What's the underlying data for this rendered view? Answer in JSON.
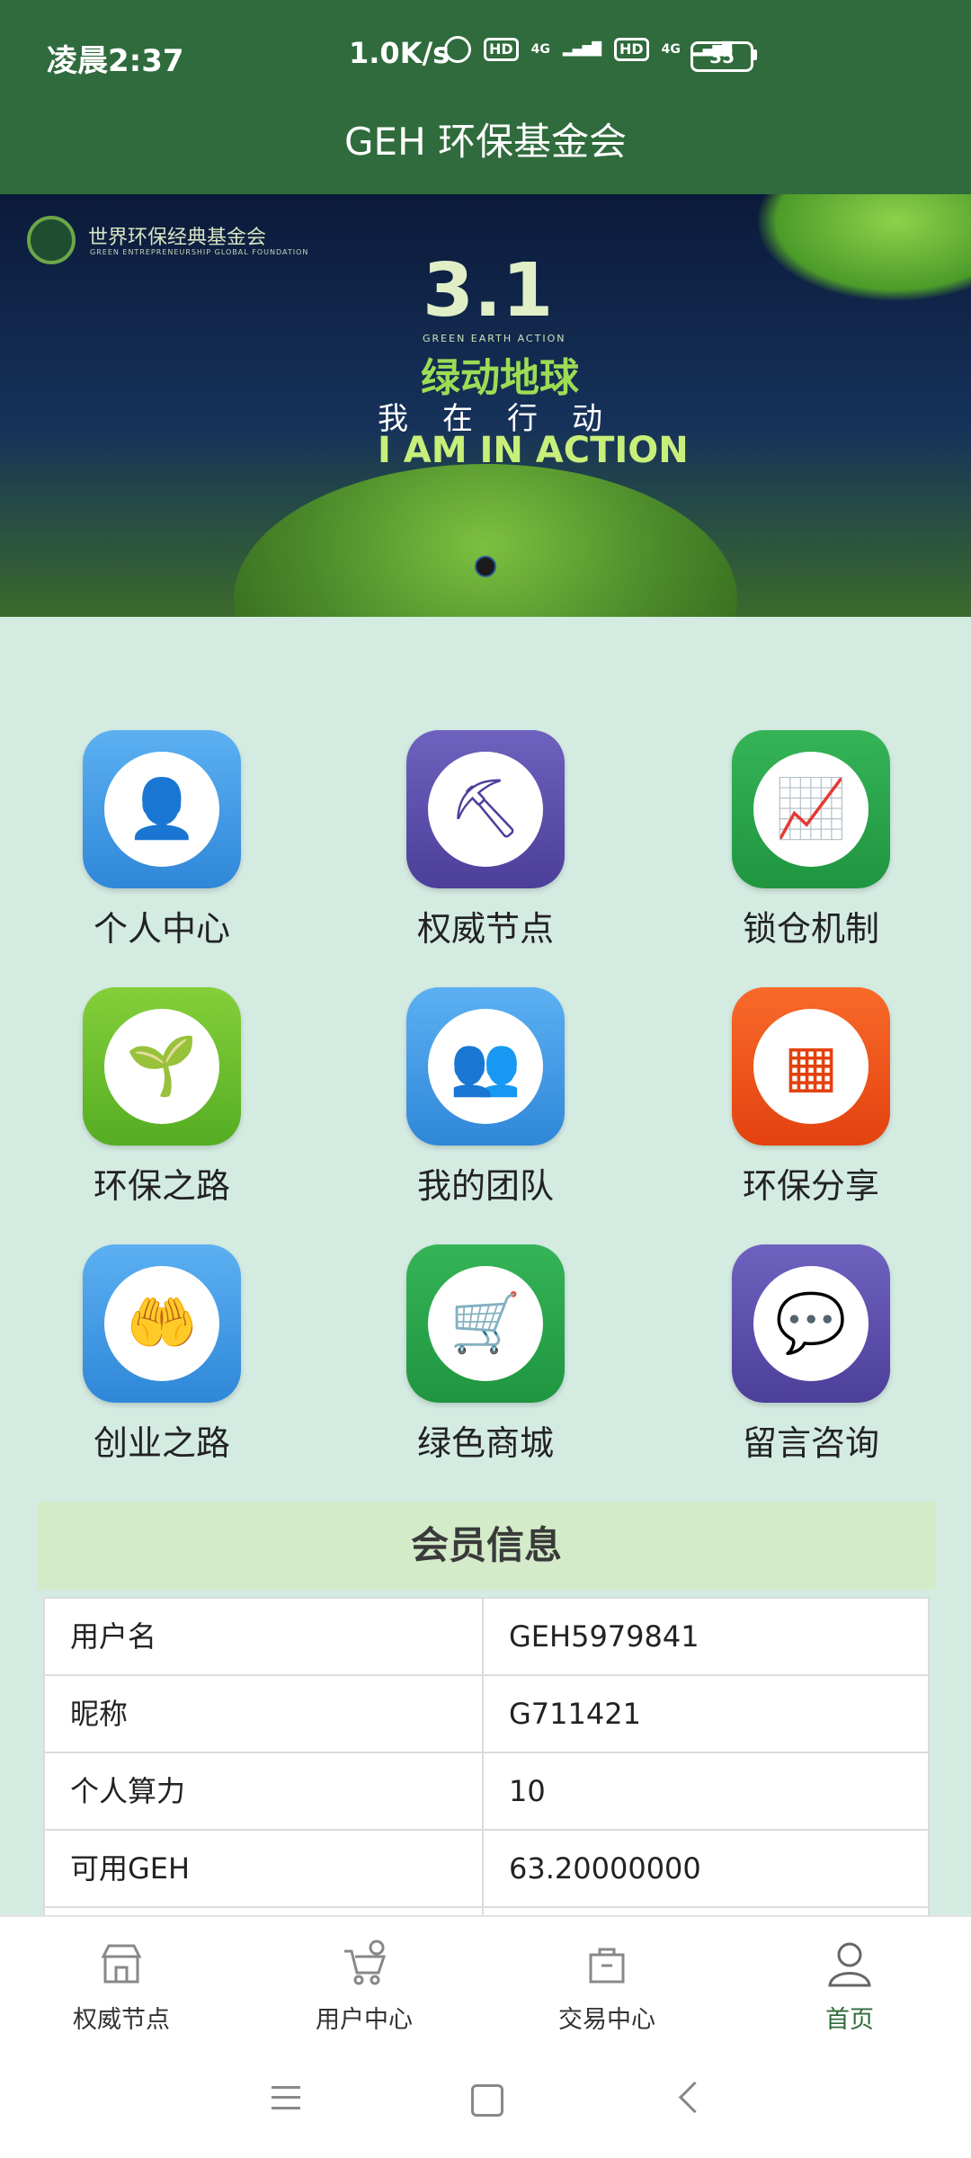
{
  "status": {
    "time": "凌晨2:37",
    "speed": "1.0K/s",
    "battery": "35",
    "hd1": "HD",
    "hd2": "HD",
    "net1": "4G",
    "net2": "4G"
  },
  "app": {
    "title": "GEH 环保基金会"
  },
  "banner": {
    "org_cn": "世界环保经典基金会",
    "org_en": "GREEN ENTREPRENEURSHIP GLOBAL FOUNDATION",
    "big": "3.1",
    "sub": "GREEN EARTH ACTION",
    "headline_cn": "绿动地球",
    "tagline_cn": "我在行动",
    "tagline_en": "I AM IN ACTION"
  },
  "menu": {
    "items": [
      {
        "label": "个人中心",
        "icon": "user-icon",
        "color": "#3a9be8"
      },
      {
        "label": "权威节点",
        "icon": "mining-pickaxe-icon",
        "color": "#5b4fa8"
      },
      {
        "label": "锁仓机制",
        "icon": "chart-up-icon",
        "color": "#2aa34a"
      },
      {
        "label": "环保之路",
        "icon": "sprout-icon",
        "color": "#6dbf2a"
      },
      {
        "label": "我的团队",
        "icon": "team-icon",
        "color": "#3a9be8"
      },
      {
        "label": "环保分享",
        "icon": "qrcode-icon",
        "color": "#f2541c"
      },
      {
        "label": "创业之路",
        "icon": "hands-icon",
        "color": "#3a9be8"
      },
      {
        "label": "绿色商城",
        "icon": "shopping-cart-icon",
        "color": "#2aa34a"
      },
      {
        "label": "留言咨询",
        "icon": "chat-bubble-icon",
        "color": "#5b4fa8"
      }
    ]
  },
  "member": {
    "title": "会员信息",
    "rows": [
      {
        "key": "用户名",
        "value": "GEH5979841"
      },
      {
        "key": "昵称",
        "value": "G711421"
      },
      {
        "key": "个人算力",
        "value": "10"
      },
      {
        "key": "可用GEH",
        "value": "63.20000000"
      }
    ]
  },
  "bottom_nav": {
    "items": [
      {
        "label": "权威节点",
        "icon": "store-icon"
      },
      {
        "label": "用户中心",
        "icon": "cart-icon"
      },
      {
        "label": "交易中心",
        "icon": "bag-icon"
      },
      {
        "label": "首页",
        "icon": "person-icon"
      }
    ]
  }
}
